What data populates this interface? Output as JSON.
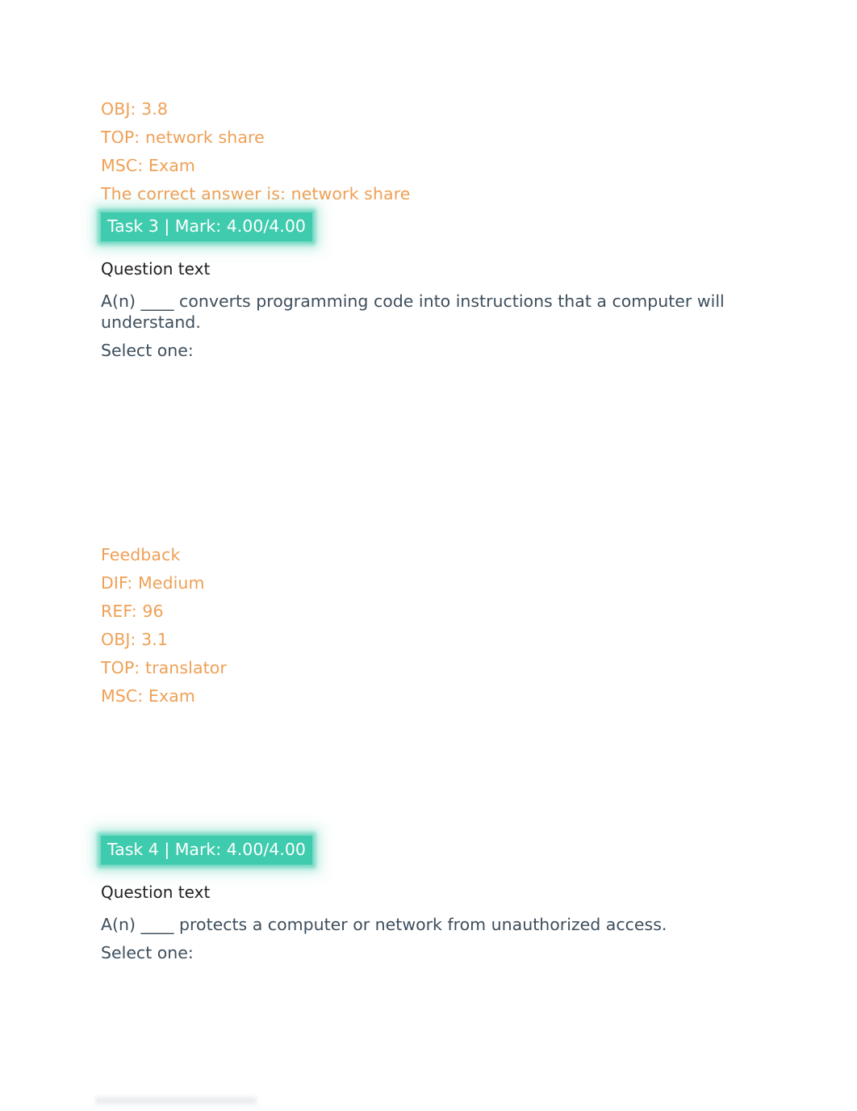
{
  "colors": {
    "feedback_orange": "#efa055",
    "task_badge_teal": "#3fcbad",
    "task_badge_text": "#ffffff",
    "question_label": "#1f1f1f",
    "question_body": "#3d4e5c",
    "page_background": "#ffffff"
  },
  "previous_question_feedback": {
    "lines": [
      "OBJ: 3.8",
      "TOP: network share",
      "MSC: Exam",
      "The correct answer is: network share"
    ]
  },
  "tasks": [
    {
      "badge": "Task 3 | Mark: 4.00/4.00",
      "question_text_label": "Question text",
      "question_body": "A(n) ____ converts programming code into instructions that a computer will understand.",
      "select_prompt": "Select one:",
      "options": [],
      "feedback": {
        "heading": "Feedback",
        "lines": [
          "DIF: Medium",
          "REF: 96",
          "OBJ: 3.1",
          "TOP: translator",
          "MSC: Exam"
        ]
      }
    },
    {
      "badge": "Task 4 | Mark: 4.00/4.00",
      "question_text_label": "Question text",
      "question_body": "A(n) ____ protects a computer or network from unauthorized access.",
      "select_prompt": "Select one:",
      "options": []
    }
  ]
}
